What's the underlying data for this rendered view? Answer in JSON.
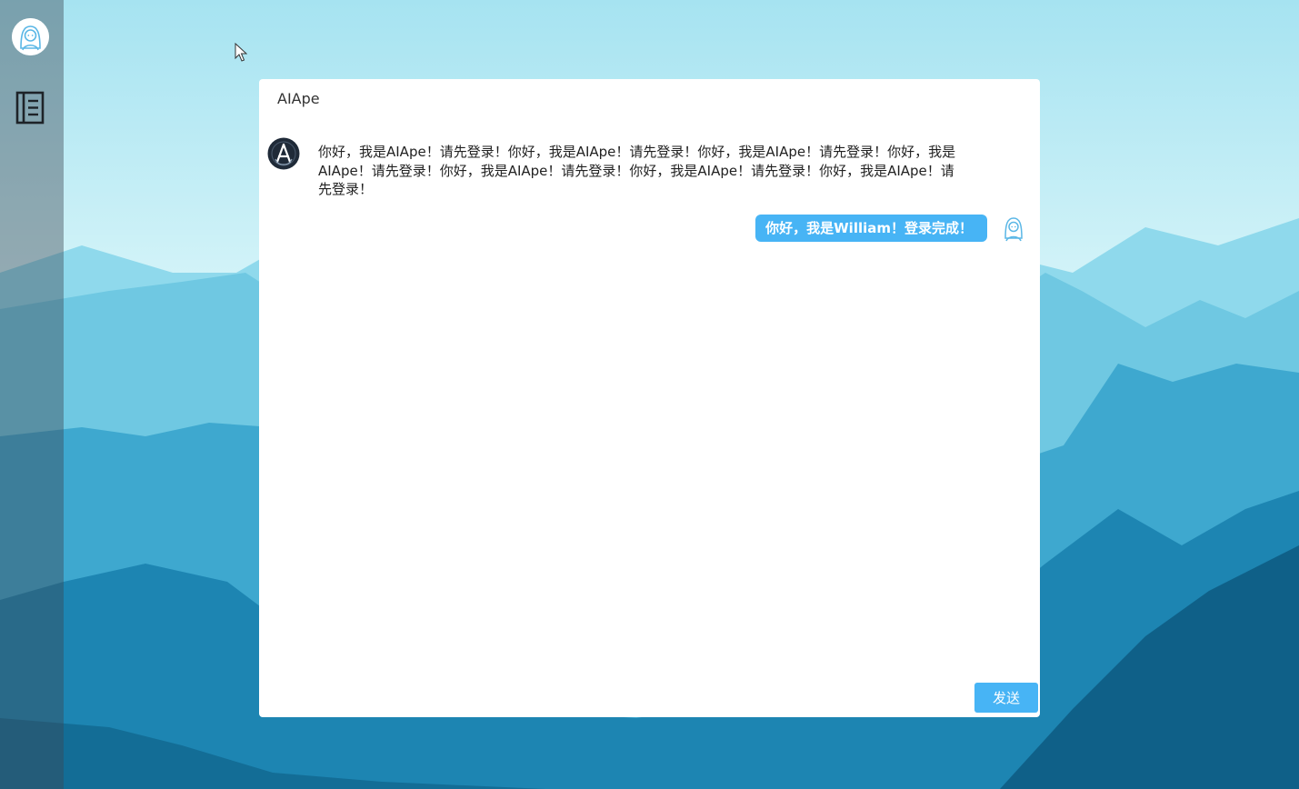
{
  "sidebar": {
    "avatar_icon": "user-avatar-icon",
    "menu_icon": "list-menu-icon"
  },
  "chat": {
    "title": "AIApe",
    "messages": [
      {
        "sender": "bot",
        "avatar_icon": "bot-avatar-icon",
        "text": "你好，我是AIApe！请先登录！你好，我是AIApe！请先登录！你好，我是AIApe！请先登录！你好，我是AIApe！请先登录！你好，我是AIApe！请先登录！你好，我是AIApe！请先登录！你好，我是AIApe！请先登录！"
      },
      {
        "sender": "user",
        "avatar_icon": "user-avatar-icon",
        "text": "你好，我是William！登录完成！"
      }
    ],
    "send_label": "发送"
  },
  "colors": {
    "accent": "#47b4f5",
    "panel_background": "#ffffff",
    "sidebar_overlay": "#3c4650"
  }
}
